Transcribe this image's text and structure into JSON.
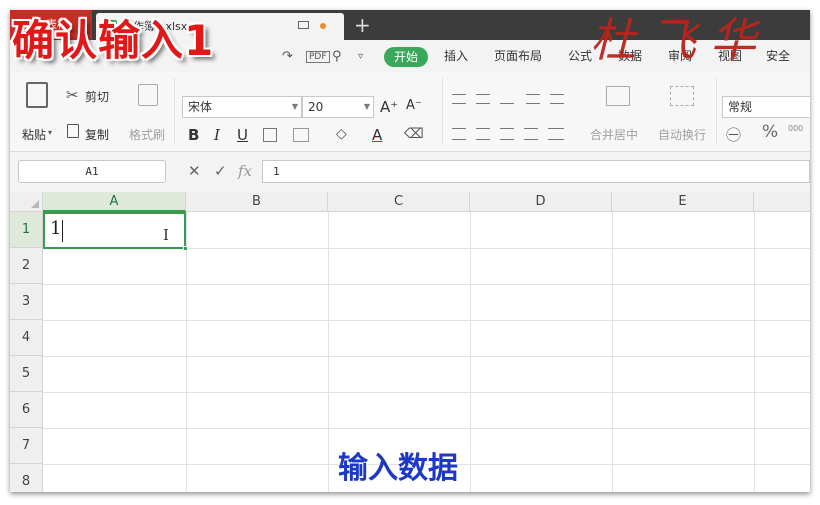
{
  "overlays": {
    "title": "确认输入1",
    "signature": "杜飞华",
    "caption": "输入数据"
  },
  "window": {
    "app_tab": "WPS 表格",
    "doc_tab": "工作簿1.xlsx",
    "new_tab": "+"
  },
  "menu": {
    "active": "开始",
    "items": [
      "插入",
      "页面布局",
      "公式",
      "数据",
      "审阅",
      "视图",
      "安全"
    ]
  },
  "ribbon": {
    "paste": "粘贴",
    "cut": "剪切",
    "copy": "复制",
    "format_painter": "格式刷",
    "font_name": "宋体",
    "font_size": "20",
    "bold": "B",
    "italic": "I",
    "underline": "U",
    "font_color": "A",
    "grow_font": "A⁺",
    "shrink_font": "A⁻",
    "merge_center": "合并居中",
    "wrap_text": "自动换行",
    "number_format": "常规",
    "percent": "%"
  },
  "formula_bar": {
    "name_box": "A1",
    "cancel": "✕",
    "confirm": "✓",
    "fx": "fx",
    "content": "1"
  },
  "sheet": {
    "columns": [
      "A",
      "B",
      "C",
      "D",
      "E"
    ],
    "rows": [
      "1",
      "2",
      "3",
      "4",
      "5",
      "6",
      "7",
      "8"
    ],
    "active_cell": "A1",
    "cell_a1": "1"
  },
  "colors": {
    "wps_red": "#c62d26",
    "accent_green": "#3aa85a",
    "title_red": "#e01818",
    "caption_blue": "#1d39c4"
  }
}
